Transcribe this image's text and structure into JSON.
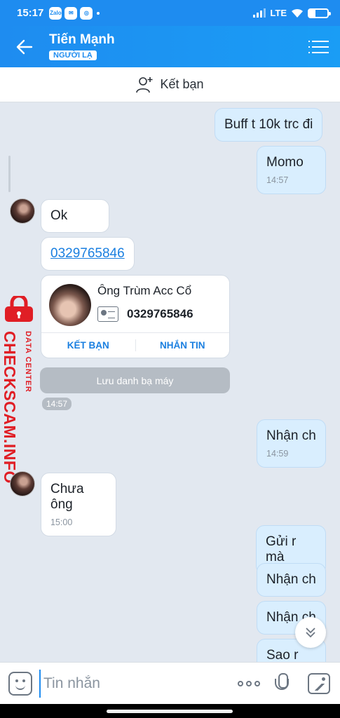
{
  "status_bar": {
    "time": "15:17",
    "network": "LTE",
    "app_icons": [
      "zalo-icon",
      "messenger-icon",
      "messenger-lite-icon"
    ],
    "battery_level": 0.35
  },
  "header": {
    "contact_name": "Tiến Mạnh",
    "badge": "NGƯỜI LẠ"
  },
  "add_friend": {
    "label": "Kết bạn"
  },
  "messages": {
    "m1": {
      "text": "Buff t 10k trc đi"
    },
    "m2": {
      "text": "Momo",
      "time": "14:57"
    },
    "m3": {
      "text": "Ok"
    },
    "m4": {
      "text": "0329765846"
    },
    "m5": {
      "text": "Nhận ch",
      "time": "14:59"
    },
    "m6": {
      "text": "Chưa ông",
      "time": "15:00"
    },
    "m7": {
      "text": "Gửi r mà"
    },
    "m8": {
      "text": "Nhận ch"
    },
    "m9": {
      "text": "Nhận ch"
    },
    "m10": {
      "text": "Sao r"
    }
  },
  "contact_card": {
    "name": "Ông Trùm Acc Cổ",
    "phone": "0329765846",
    "add_friend_label": "KẾT BẠN",
    "message_label": "NHẮN TIN"
  },
  "save_contact_label": "Lưu danh bạ máy",
  "time_chip": "14:57",
  "watermark": {
    "small": "DATA CENTER",
    "big": "CHECKSCAM.INFO"
  },
  "input": {
    "placeholder": "Tin nhắn"
  },
  "colors": {
    "header": "#1e8cf0",
    "my_bubble": "#d9eefe",
    "link": "#1a7fe0",
    "watermark": "#e01e25"
  }
}
